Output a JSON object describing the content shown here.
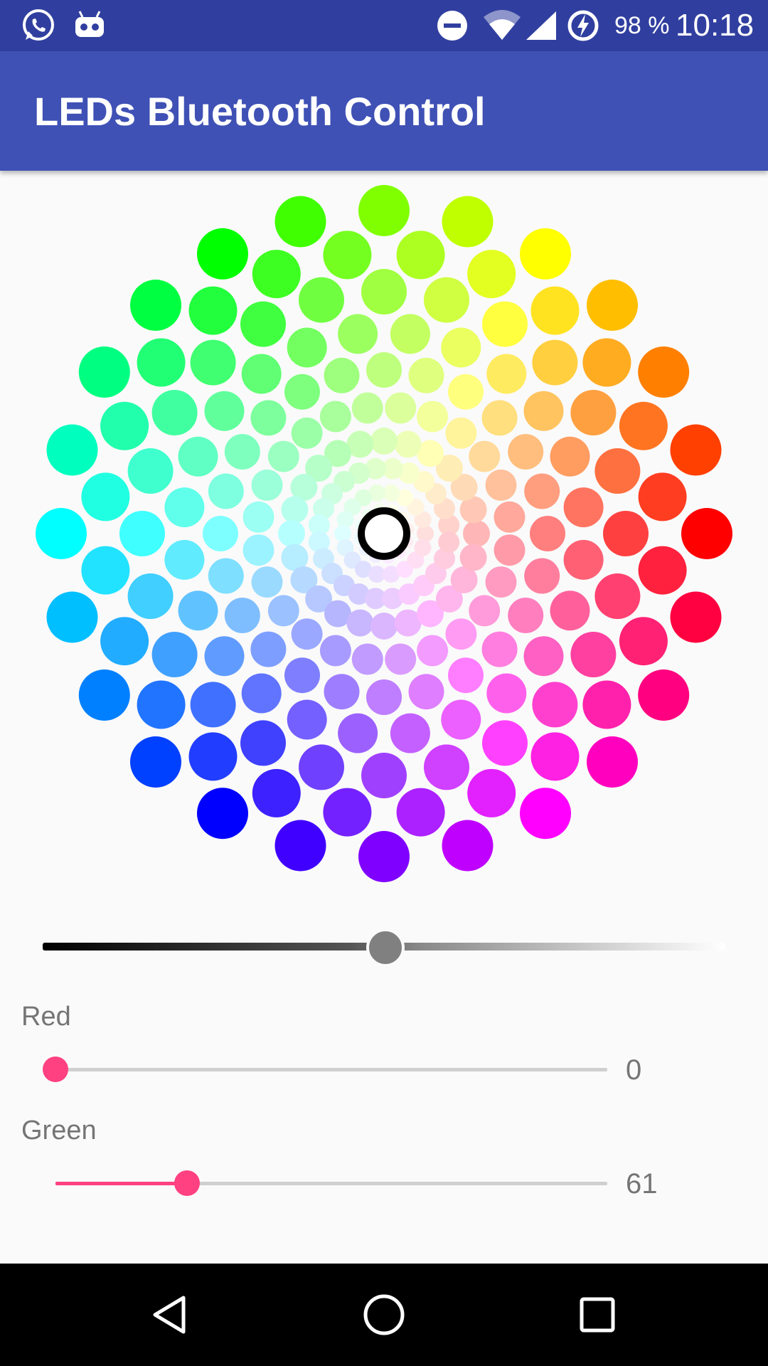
{
  "status_bar": {
    "icons": [
      "whatsapp-icon",
      "android-debug-icon",
      "do-not-disturb-icon",
      "wifi-icon",
      "cellular-signal-icon",
      "battery-charging-icon"
    ],
    "battery_text": "98 %",
    "clock": "10:18"
  },
  "app_bar": {
    "title": "LEDs Bluetooth Control"
  },
  "color_wheel": {
    "selected_color": "#ffffff",
    "colors": {
      "red": "#ff0000",
      "yellow": "#ffff00",
      "green": "#00ff00",
      "cyan": "#00ffff",
      "blue": "#0000ff",
      "magenta": "#ff00ff"
    }
  },
  "value_slider": {
    "level": 0.5
  },
  "channels": [
    {
      "label": "Red",
      "value": "0",
      "fraction": 0.0
    },
    {
      "label": "Green",
      "value": "61",
      "fraction": 0.239
    }
  ],
  "accent_color": "#FF4081",
  "primary_color": "#3F51B5",
  "primary_dark_color": "#303F9F",
  "nav_bar": {
    "buttons": [
      "back-icon",
      "home-icon",
      "recents-icon"
    ]
  }
}
